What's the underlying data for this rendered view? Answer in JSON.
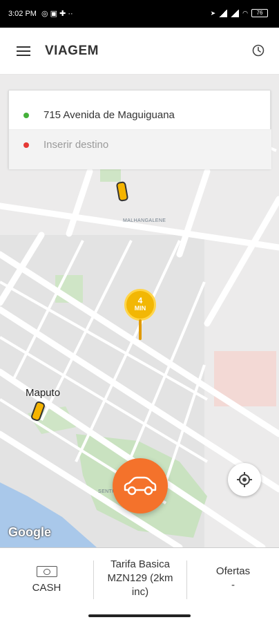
{
  "status_bar": {
    "time": "3:02 PM",
    "left_icons": "◎ ▣ ✚ ··",
    "battery": "76"
  },
  "app_bar": {
    "title": "VIAGEM"
  },
  "route": {
    "origin": "715 Avenida de Maguiguana",
    "destination_placeholder": "Inserir destino",
    "origin_dot_color": "#45b03a",
    "destination_dot_color": "#e53935"
  },
  "map": {
    "neighborhood_label": "MALHANGALENE",
    "city_label": "Maputo",
    "small_label": "SENTR",
    "attribution": "Google",
    "pin": {
      "value": "4",
      "unit": "MIN"
    }
  },
  "fab": {
    "icon": "car-icon",
    "color": "#f4722b"
  },
  "bottom_bar": {
    "cash": "CASH",
    "tarifa_line1": "Tarifa Basica",
    "tarifa_line2": "MZN129 (2km",
    "tarifa_line3": "inc)",
    "ofertas": "Ofertas",
    "ofertas_value": "-"
  }
}
